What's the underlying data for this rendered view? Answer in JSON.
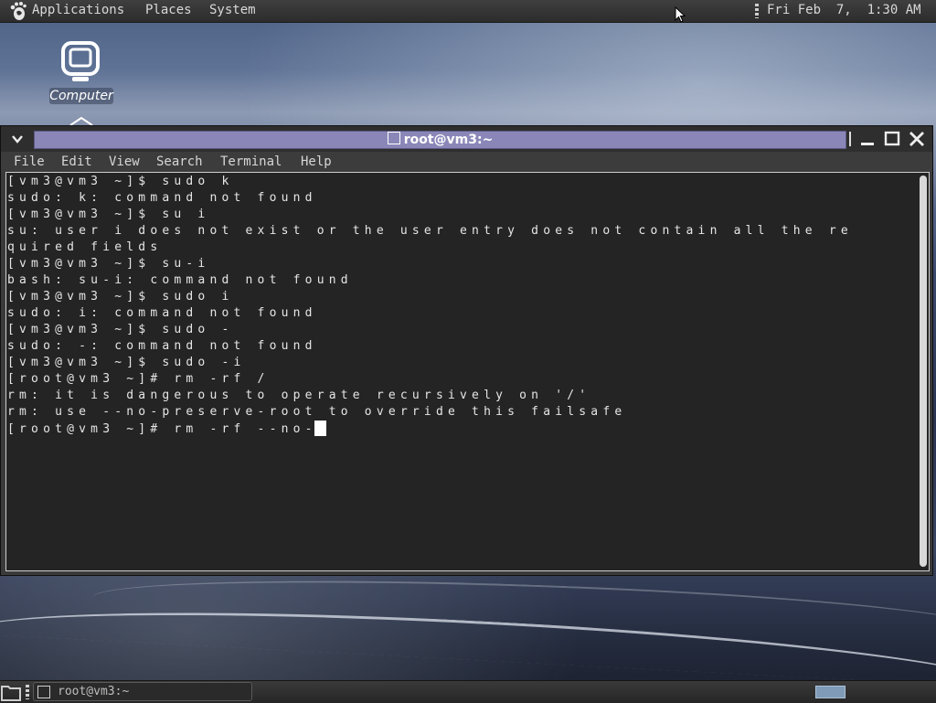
{
  "top_panel": {
    "menus": [
      "Applications",
      "Places",
      "System"
    ],
    "clock": "Fri Feb  7,  1:30 AM"
  },
  "desktop": {
    "icons": [
      {
        "label": "Computer",
        "icon": "computer-icon"
      }
    ]
  },
  "window": {
    "title": "root@vm3:~",
    "menus": [
      "File",
      "Edit",
      "View",
      "Search",
      "Terminal",
      "Help"
    ],
    "terminal_lines": [
      "[vm3@vm3 ~]$ sudo k",
      "sudo: k: command not found",
      "[vm3@vm3 ~]$ su i",
      "su: user i does not exist or the user entry does not contain all the re",
      "quired fields",
      "[vm3@vm3 ~]$ su-i",
      "bash: su-i: command not found",
      "[vm3@vm3 ~]$ sudo i",
      "sudo: i: command not found",
      "[vm3@vm3 ~]$ sudo -",
      "sudo: -: command not found",
      "[vm3@vm3 ~]$ sudo -i",
      "[root@vm3 ~]# rm -rf /",
      "rm: it is dangerous to operate recursively on '/'",
      "rm: use --no-preserve-root to override this failsafe"
    ],
    "prompt_line": "[root@vm3 ~]# rm -rf --no-"
  },
  "bottom_panel": {
    "task_label": "root@vm3:~"
  },
  "colors": {
    "title_strip": "#8a87b8",
    "terminal_bg": "#242424",
    "terminal_fg": "#e6e6e6",
    "workspace": "#7f9bb8"
  }
}
